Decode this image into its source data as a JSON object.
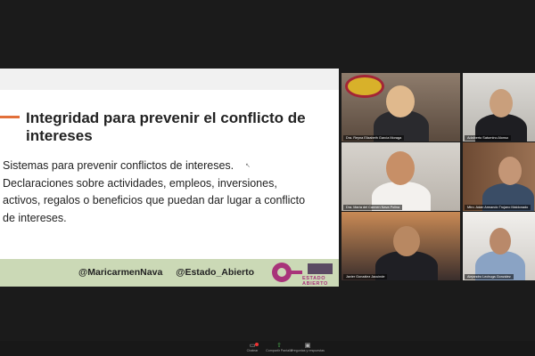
{
  "slide": {
    "title": "Integridad para prevenir el conflicto de intereses",
    "bullets": [
      "Sistemas para prevenir conflictos de intereses.",
      "Declaraciones sobre actividades, empleos, inversiones,",
      "activos, regalos o beneficios que puedan dar lugar a conflicto",
      "de intereses."
    ],
    "footer_handles": [
      "@MaricarmenNava",
      "@Estado_Abierto"
    ],
    "logo_text": "ESTADO ABIERTO"
  },
  "participants": [
    {
      "name": "Dra. Reyna Elizabeth García Moraga",
      "speaking": false
    },
    {
      "name": "Adalberto Saturnino Alonso",
      "speaking": false
    },
    {
      "name": "Dra. María del Carmen Nava Polina",
      "speaking": true
    },
    {
      "name": "Mtro. Adán Armando Trujano Maldonado",
      "speaking": false
    },
    {
      "name": "Javier González Jacuinde",
      "speaking": false
    },
    {
      "name": "Alejandro Lechuga González",
      "speaking": false
    }
  ],
  "toolbar": {
    "chat_label": "Chatear",
    "share_label": "Compartir Pantalla",
    "qa_label": "Preguntas y respuestas"
  },
  "colors": {
    "accent_orange": "#e2703a",
    "footer_green": "#cbd9b6",
    "brand_magenta": "#a8347a",
    "active_speaker": "#d6d82e"
  }
}
